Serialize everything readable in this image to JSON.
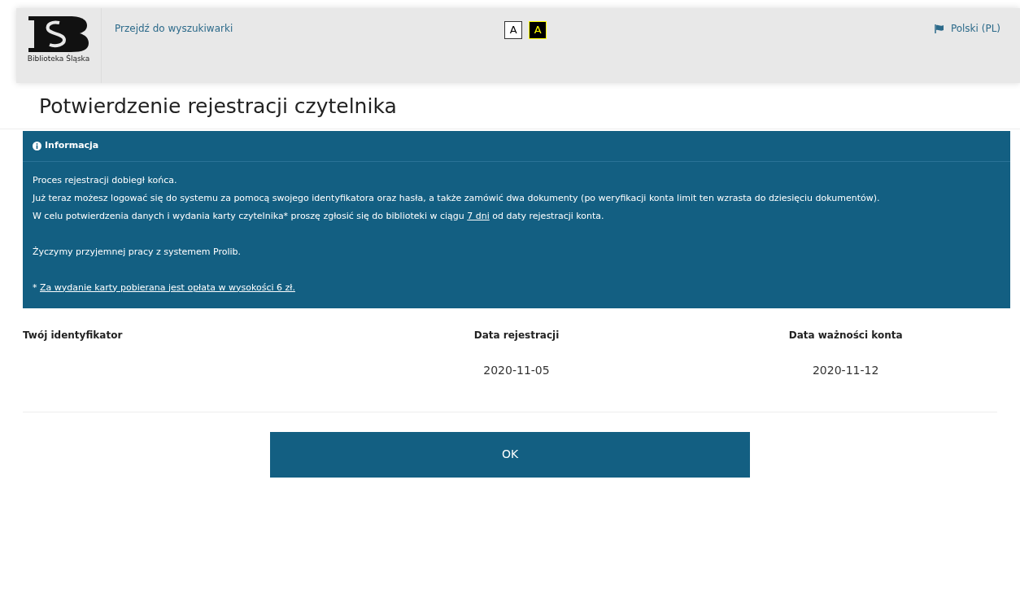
{
  "header": {
    "logo_caption": "Biblioteka Śląska",
    "search_link": "Przejdź do wyszukiwarki",
    "contrast_buttons": [
      {
        "label": "A",
        "kind": "normal"
      },
      {
        "label": "A",
        "kind": "high"
      }
    ],
    "language": "Polski (PL)"
  },
  "title": "Potwierdzenie rejestracji czytelnika",
  "info": {
    "heading": "Informacja",
    "paragraphs": [
      {
        "lines": [
          {
            "parts": [
              "Proces rejestracji dobiegł końca."
            ]
          },
          {
            "parts": [
              "Już teraz możesz logować się do systemu za pomocą swojego identyfikatora oraz hasła, a także zamówić dwa dokumenty (po weryfikacji konta limit ten wzrasta do dziesięciu dokumentów)."
            ]
          },
          {
            "parts": [
              "W celu potwierdzenia danych i wydania karty czytelnika* proszę zgłosić się do biblioteki w ciągu ",
              "7 dni",
              " od daty rejestracji konta."
            ]
          }
        ]
      },
      {
        "lines": [
          {
            "parts": [
              "Życzymy przyjemnej pracy z systemem Prolib."
            ]
          }
        ]
      },
      {
        "lines": [
          {
            "parts": [
              "* ",
              "Za wydanie karty pobierana jest opłata w wysokości 6 zł."
            ]
          }
        ]
      }
    ]
  },
  "fields": [
    {
      "label": "Twój identyfikator"
    },
    {
      "label": "Data rejestracji",
      "value": "2020-11-05"
    },
    {
      "label": "Data ważności konta",
      "value": "2020-11-12"
    }
  ],
  "ok_button": "OK"
}
